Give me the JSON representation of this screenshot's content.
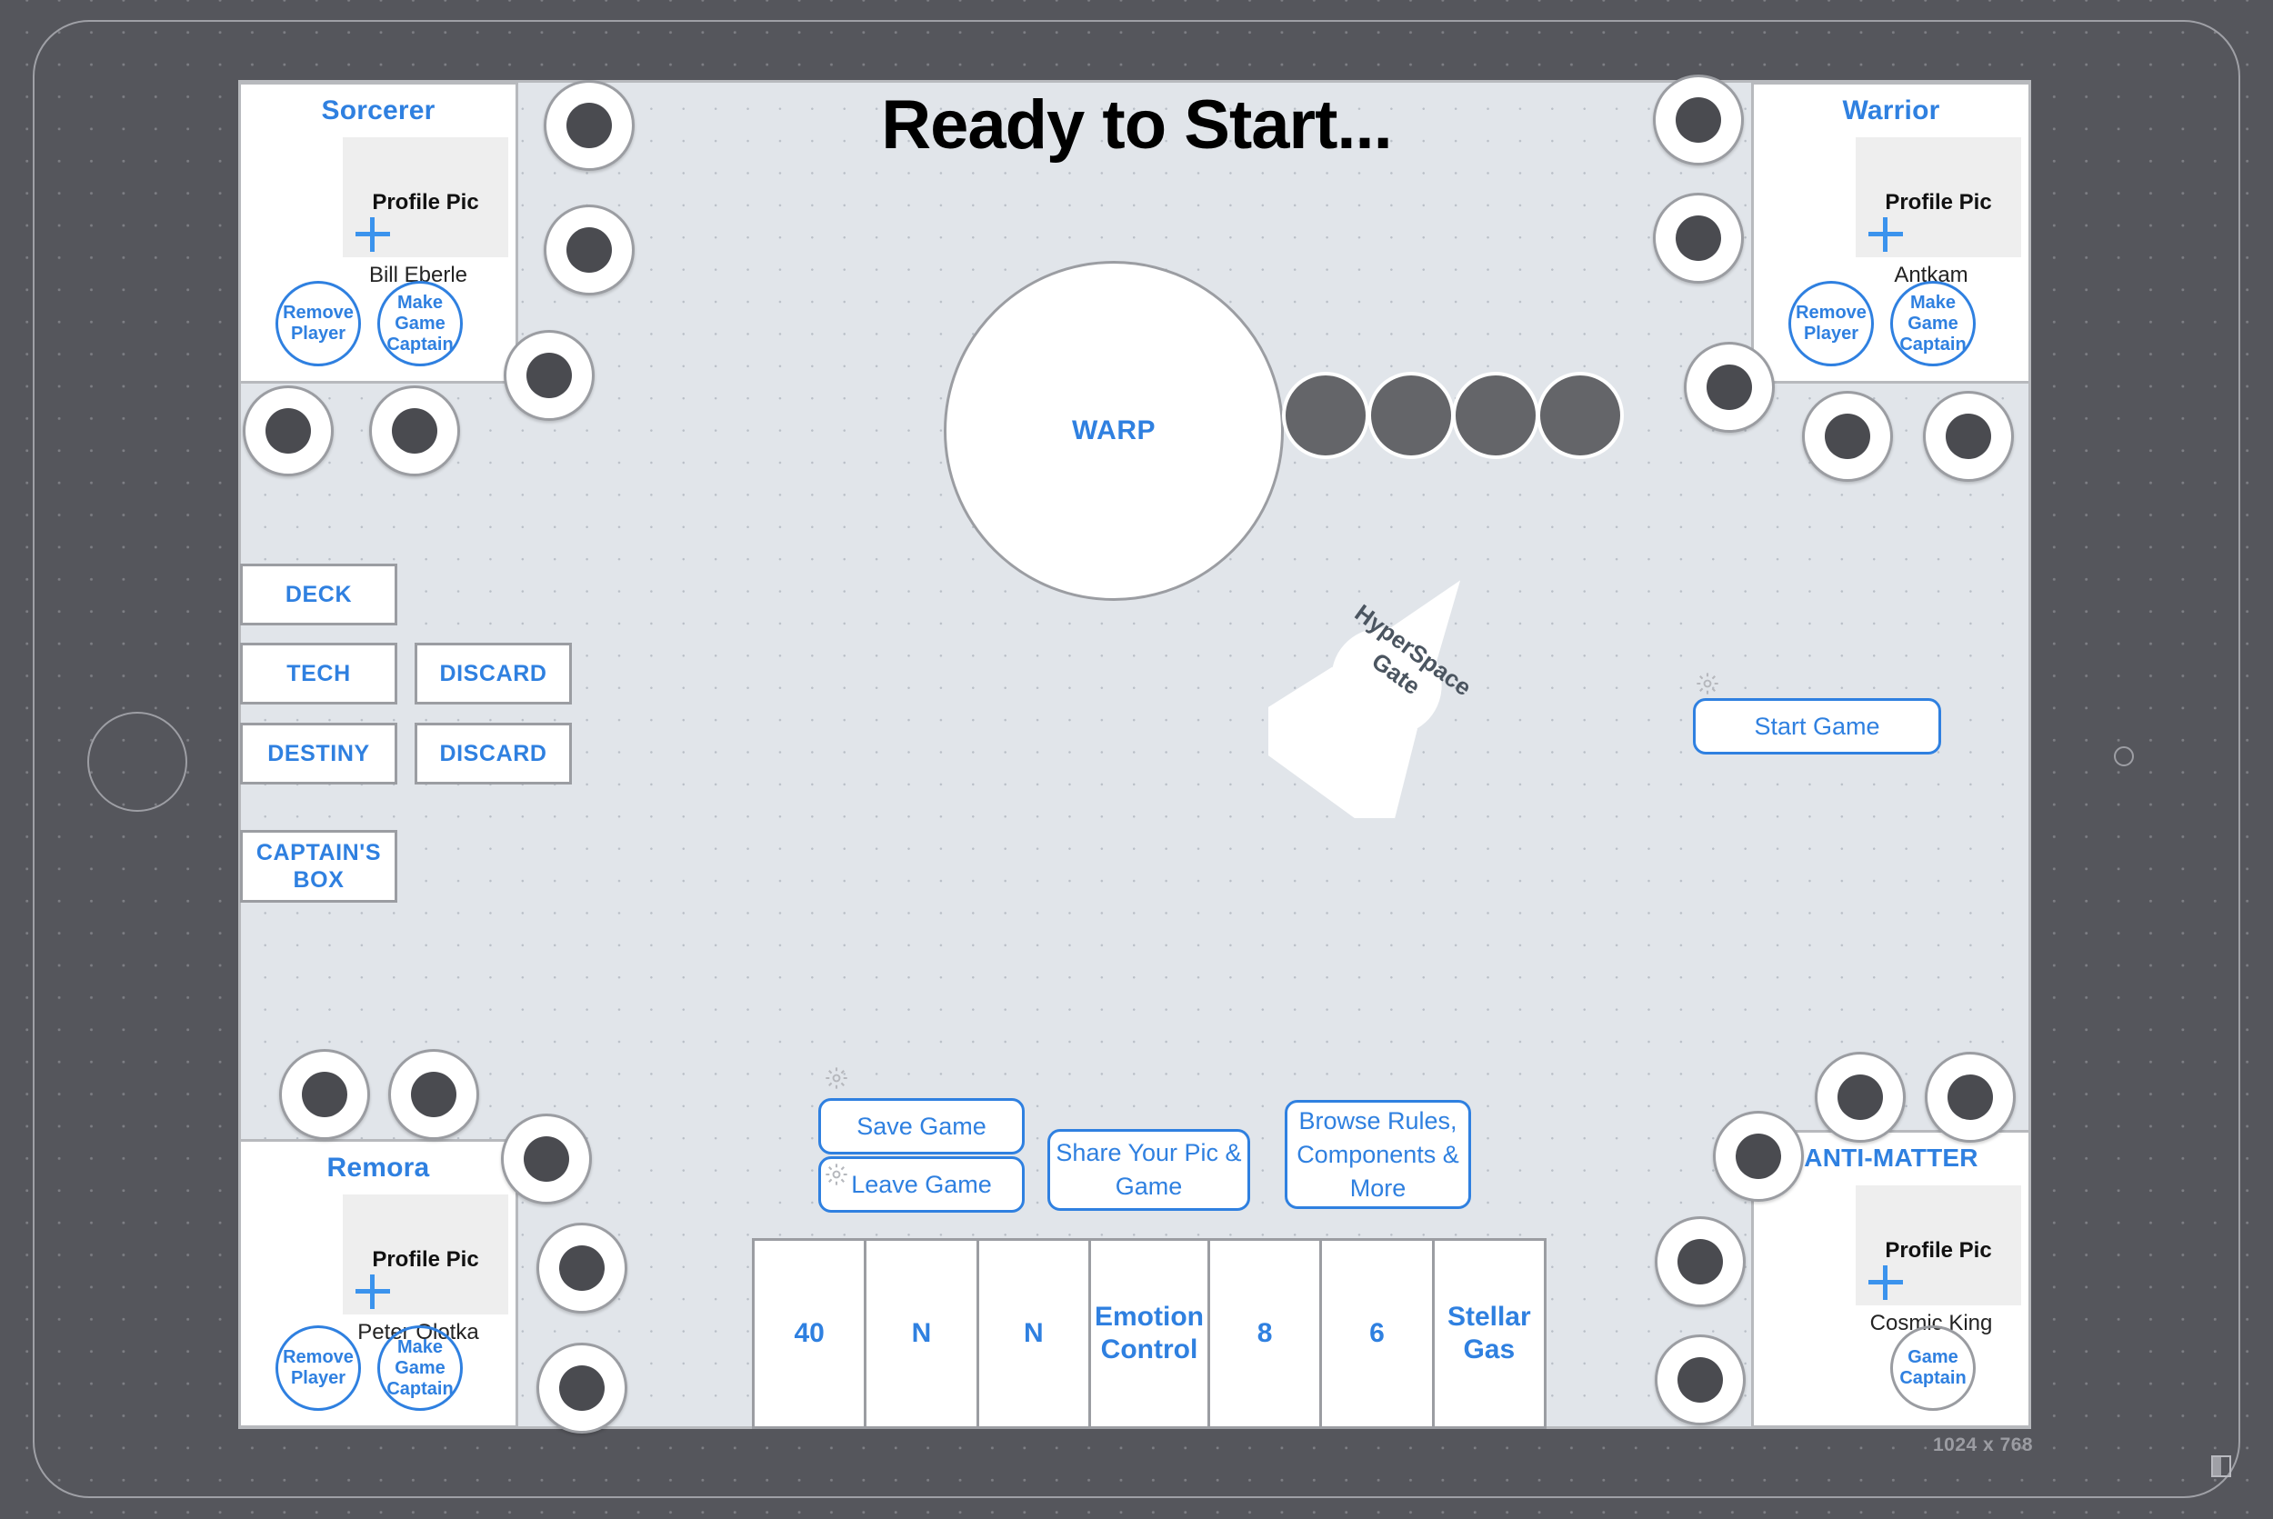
{
  "device": {
    "size_label": "1024 x 768"
  },
  "board": {
    "title": "Ready to Start...",
    "warp": {
      "label": "WARP",
      "ships": 4
    },
    "hyperspace_gate": {
      "label_line1": "HyperSpace",
      "label_line2": "Gate"
    }
  },
  "players": [
    {
      "alien": "Sorcerer",
      "name": "Bill Eberle",
      "profile_pic_label": "Profile Pic",
      "add_pic_icon": "plus-icon",
      "buttons": [
        {
          "label": "Remove Player",
          "style": "blue"
        },
        {
          "label": "Make Game Captain",
          "style": "blue"
        }
      ]
    },
    {
      "alien": "Warrior",
      "name": "Antkam",
      "profile_pic_label": "Profile Pic",
      "add_pic_icon": "plus-icon",
      "buttons": [
        {
          "label": "Remove Player",
          "style": "blue"
        },
        {
          "label": "Make Game Captain",
          "style": "blue"
        }
      ]
    },
    {
      "alien": "Remora",
      "name": "Peter Olotka",
      "profile_pic_label": "Profile Pic",
      "add_pic_icon": "plus-icon",
      "buttons": [
        {
          "label": "Remove Player",
          "style": "blue"
        },
        {
          "label": "Make Game Captain",
          "style": "blue"
        }
      ]
    },
    {
      "alien": "ANTI-MATTER",
      "name": "Cosmic King",
      "profile_pic_label": "Profile Pic",
      "add_pic_icon": "plus-icon",
      "buttons": [
        {
          "label": "Game Captain",
          "style": "gray"
        }
      ]
    }
  ],
  "decks": [
    {
      "label": "DECK"
    },
    {
      "label": "TECH"
    },
    {
      "label": "DISCARD"
    },
    {
      "label": "DESTINY"
    },
    {
      "label": "DISCARD"
    },
    {
      "label": "CAPTAIN'S BOX"
    }
  ],
  "actions": {
    "start_game": "Start Game",
    "save_game": "Save Game",
    "leave_game": "Leave Game",
    "share": "Share Your Pic & Game",
    "browse": "Browse Rules, Components & More",
    "gear_icon": "gear-icon"
  },
  "hand_cards": [
    {
      "label": "40"
    },
    {
      "label": "N"
    },
    {
      "label": "N"
    },
    {
      "label": "Emotion Control"
    },
    {
      "label": "8"
    },
    {
      "label": "6"
    },
    {
      "label": "Stellar Gas"
    }
  ],
  "colors": {
    "accent_blue": "#2f80e0",
    "board_bg": "#e1e5ea",
    "frame_gray": "#55565c",
    "planet_core": "#4a4b50"
  }
}
